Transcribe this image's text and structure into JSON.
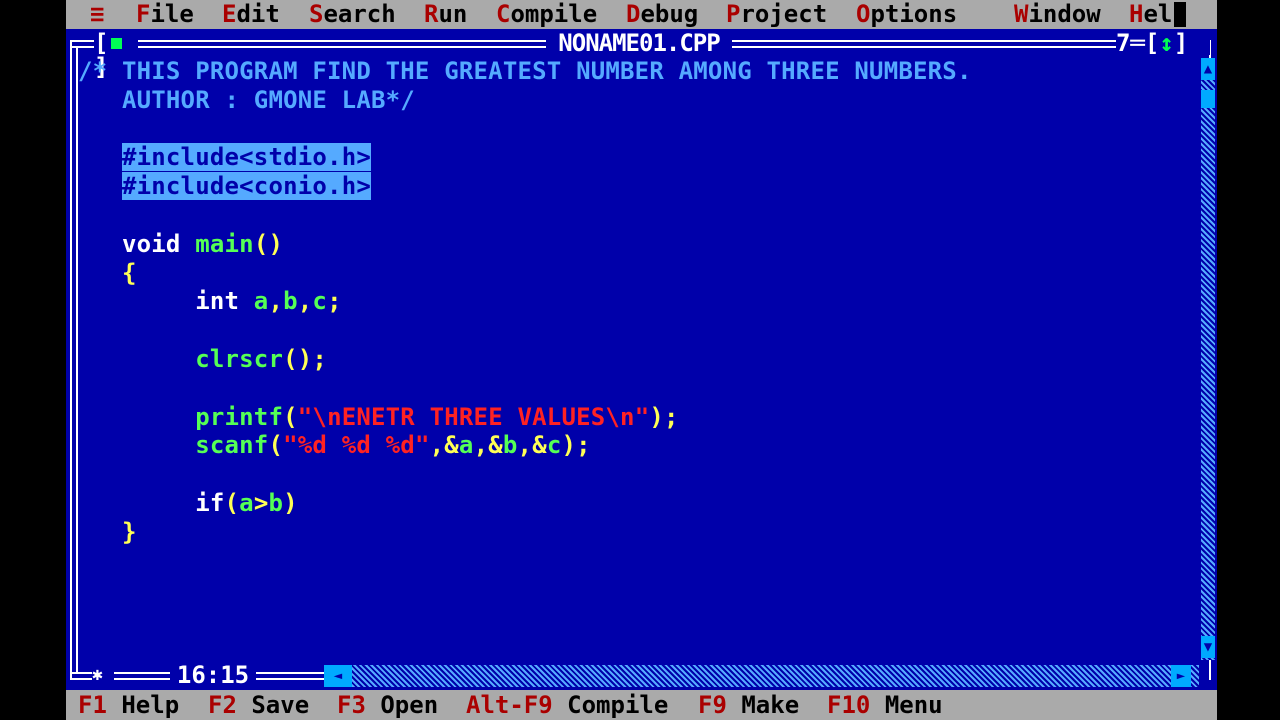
{
  "menubar": {
    "system_icon": "≡",
    "items": [
      {
        "hot": "F",
        "rest": "ile"
      },
      {
        "hot": "E",
        "rest": "dit"
      },
      {
        "hot": "S",
        "rest": "earch"
      },
      {
        "hot": "R",
        "rest": "un"
      },
      {
        "hot": "C",
        "rest": "ompile"
      },
      {
        "hot": "D",
        "rest": "ebug"
      },
      {
        "hot": "P",
        "rest": "roject"
      },
      {
        "hot": "O",
        "rest": "ptions"
      },
      {
        "hot": "W",
        "rest": "indow"
      },
      {
        "hot": "H",
        "rest": "elp"
      }
    ]
  },
  "editor": {
    "title": "NONAME01.CPP",
    "window_number": "7",
    "cursor_position": "16:15",
    "code_lines": [
      [
        {
          "text": "/* THIS PROGRAM FIND THE GREATEST NUMBER AMONG THREE NUMBERS.",
          "style": "comment"
        }
      ],
      [
        {
          "text": "   AUTHOR : GMONE LAB*/",
          "style": "comment"
        }
      ],
      [],
      [
        {
          "text": "   ",
          "style": "white"
        },
        {
          "text": "#include<stdio.h>",
          "style": "pp"
        }
      ],
      [
        {
          "text": "   ",
          "style": "white"
        },
        {
          "text": "#include<conio.h>",
          "style": "pp"
        }
      ],
      [],
      [
        {
          "text": "   void ",
          "style": "white"
        },
        {
          "text": "main",
          "style": "green"
        },
        {
          "text": "()",
          "style": "yellow"
        }
      ],
      [
        {
          "text": "   {",
          "style": "yellow"
        }
      ],
      [
        {
          "text": "        int ",
          "style": "white"
        },
        {
          "text": "a",
          "style": "green"
        },
        {
          "text": ",",
          "style": "yellow"
        },
        {
          "text": "b",
          "style": "green"
        },
        {
          "text": ",",
          "style": "yellow"
        },
        {
          "text": "c",
          "style": "green"
        },
        {
          "text": ";",
          "style": "yellow"
        }
      ],
      [],
      [
        {
          "text": "        ",
          "style": "white"
        },
        {
          "text": "clrscr",
          "style": "green"
        },
        {
          "text": "();",
          "style": "yellow"
        }
      ],
      [],
      [
        {
          "text": "        ",
          "style": "white"
        },
        {
          "text": "printf",
          "style": "green"
        },
        {
          "text": "(",
          "style": "yellow"
        },
        {
          "text": "\"\\nENETR THREE VALUES\\n\"",
          "style": "red"
        },
        {
          "text": ");",
          "style": "yellow"
        }
      ],
      [
        {
          "text": "        ",
          "style": "white"
        },
        {
          "text": "scanf",
          "style": "green"
        },
        {
          "text": "(",
          "style": "yellow"
        },
        {
          "text": "\"%d %d %d\"",
          "style": "red"
        },
        {
          "text": ",&",
          "style": "yellow"
        },
        {
          "text": "a",
          "style": "green"
        },
        {
          "text": ",&",
          "style": "yellow"
        },
        {
          "text": "b",
          "style": "green"
        },
        {
          "text": ",&",
          "style": "yellow"
        },
        {
          "text": "c",
          "style": "green"
        },
        {
          "text": ");",
          "style": "yellow"
        }
      ],
      [],
      [
        {
          "text": "        if",
          "style": "white"
        },
        {
          "text": "(",
          "style": "yellow"
        },
        {
          "text": "a",
          "style": "green"
        },
        {
          "text": ">",
          "style": "yellow"
        },
        {
          "text": "b",
          "style": "green"
        },
        {
          "text": ")",
          "style": "yellow"
        }
      ],
      [
        {
          "text": "   }",
          "style": "yellow"
        }
      ]
    ]
  },
  "statusbar": {
    "items": [
      {
        "key": "F1",
        "label": "Help"
      },
      {
        "key": "F2",
        "label": "Save"
      },
      {
        "key": "F3",
        "label": "Open"
      },
      {
        "key": "Alt-F9",
        "label": "Compile"
      },
      {
        "key": "F9",
        "label": "Make"
      },
      {
        "key": "F10",
        "label": "Menu"
      }
    ]
  },
  "colors": {
    "background": "#0000AA",
    "menu_bg": "#AAAAAA",
    "hotkey": "#AA0000",
    "comment": "#55AAFF",
    "keyword": "#FFFFFF",
    "identifier": "#55FF55",
    "punctuation": "#FFFF55",
    "string": "#FF2222"
  }
}
